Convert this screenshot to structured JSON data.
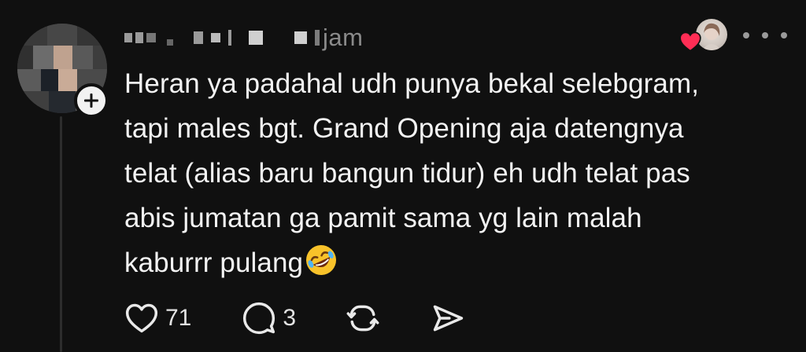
{
  "post": {
    "timestamp": "jam",
    "text": "Heran ya padahal udh punya bekal selebgram,\ntapi males bgt. Grand Opening aja datengnya\ntelat (alias baru bangun tidur) eh udh telat pas\nabis jumatan ga pamit sama yg lain malah\nkaburrr pulang",
    "emoji_icon": "rolling-on-floor-laughing-emoji"
  },
  "actions": {
    "likes": "71",
    "replies": "3"
  },
  "colors": {
    "background": "#101010",
    "text": "#f3f3f3",
    "muted": "#8a8a8a",
    "heart": "#ff2d55"
  }
}
